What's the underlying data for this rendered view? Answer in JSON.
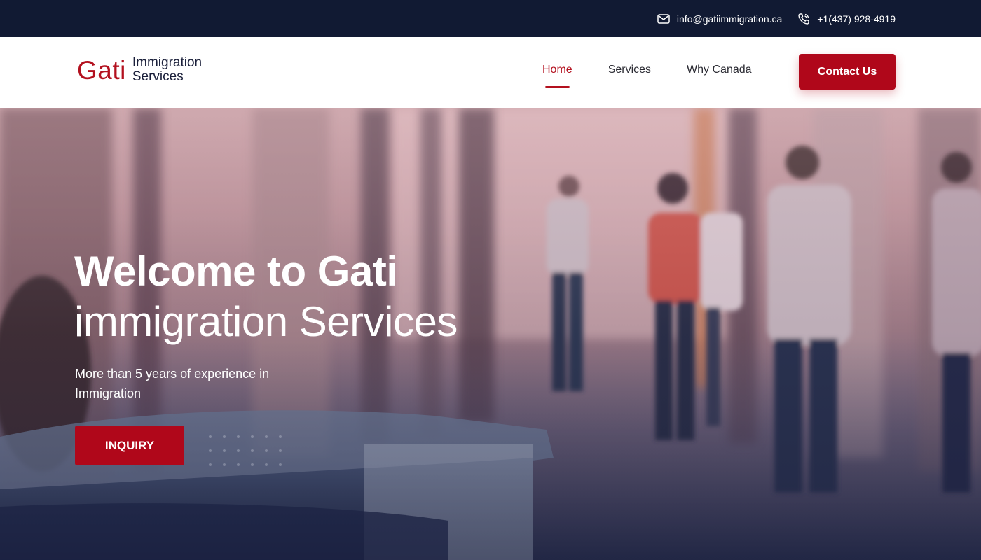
{
  "topbar": {
    "email": "info@gatiimmigration.ca",
    "email_icon": "mail-icon",
    "phone": "+1(437) 928-4919",
    "phone_icon": "phone-icon"
  },
  "brand": {
    "name": "Gati",
    "line1": "Immigration",
    "line2": "Services",
    "color": "#b3101e"
  },
  "nav": {
    "items": [
      {
        "label": "Home",
        "active": true
      },
      {
        "label": "Services",
        "active": false
      },
      {
        "label": "Why Canada",
        "active": false
      }
    ],
    "cta_label": "Contact Us"
  },
  "hero": {
    "title_line1": "Welcome to Gati",
    "title_line2": "immigration Services",
    "subtitle": "More than 5 years of experience in Immigration",
    "button_label": "INQUIRY"
  },
  "colors": {
    "topbar_bg": "#111a33",
    "accent": "#b0071a"
  }
}
